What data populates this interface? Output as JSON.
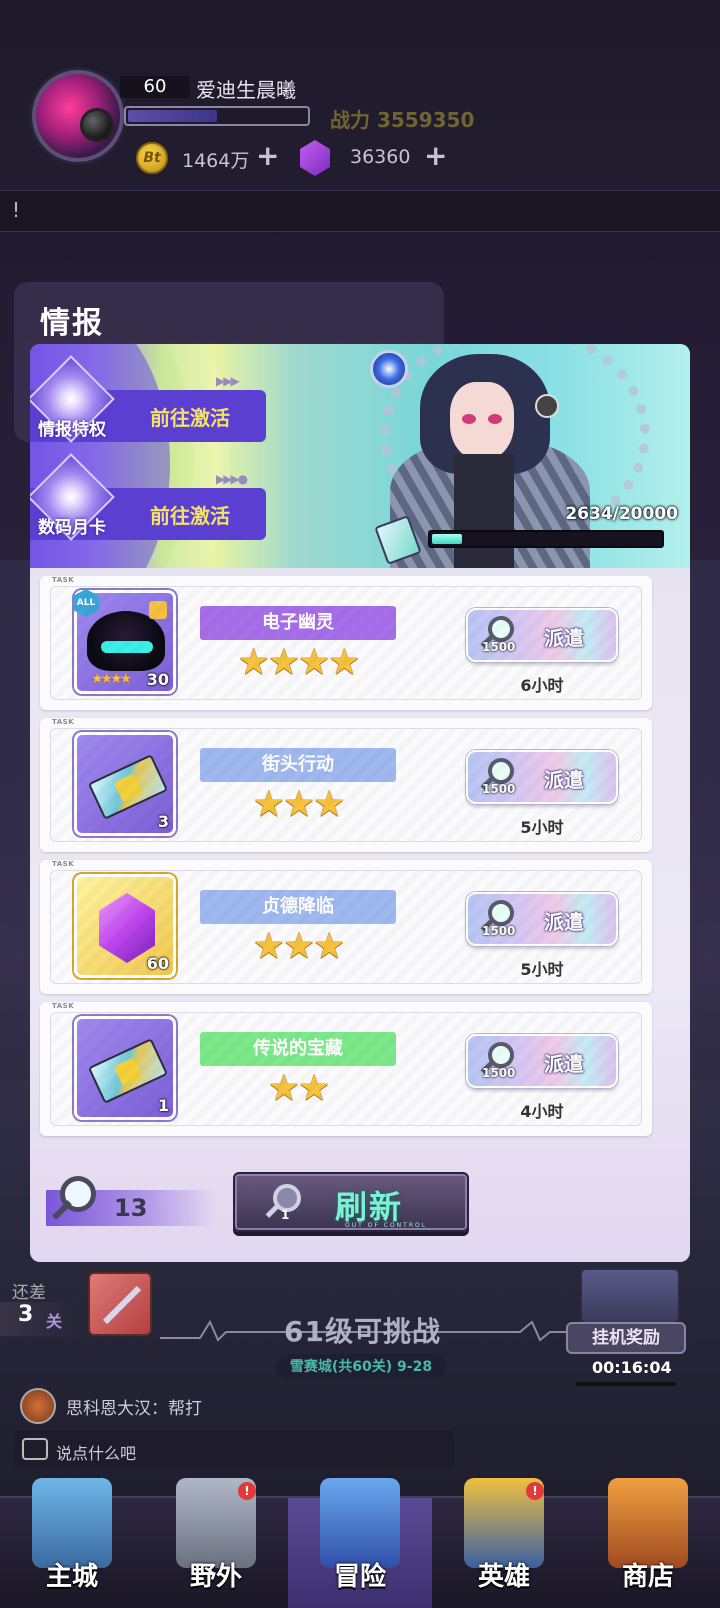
{
  "player": {
    "level": "60",
    "name": "爱迪生晨曦",
    "power_label": "战力 3559350",
    "xp_fraction": 0.49,
    "gold": "1464万",
    "gems": "36360"
  },
  "notice": "!",
  "modal": {
    "title": "情报",
    "privileges": [
      {
        "label": "情报特权",
        "action": "前往激活"
      },
      {
        "label": "数码月卡",
        "action": "前往激活"
      }
    ],
    "progress_text": "2634/20000",
    "progress_fraction": 0.1317,
    "tasks": [
      {
        "tag": "TASK",
        "item_kind": "hero",
        "badge": "ALL",
        "count": "30",
        "name": "电子幽灵",
        "name_color": "purple",
        "stars": 4,
        "cost": "1500",
        "action": "派遣",
        "duration": "6小时"
      },
      {
        "tag": "TASK",
        "item_kind": "ticket",
        "count": "3",
        "name": "街头行动",
        "name_color": "blue",
        "stars": 3,
        "cost": "1500",
        "action": "派遣",
        "duration": "5小时"
      },
      {
        "tag": "TASK",
        "item_kind": "gem",
        "count": "60",
        "name": "贞德降临",
        "name_color": "blue",
        "stars": 3,
        "cost": "1500",
        "action": "派遣",
        "duration": "5小时"
      },
      {
        "tag": "TASK",
        "item_kind": "ticket",
        "count": "1",
        "name": "传说的宝藏",
        "name_color": "green",
        "stars": 2,
        "cost": "1500",
        "action": "派遣",
        "duration": "4小时"
      }
    ],
    "scope_count": "13",
    "refresh": {
      "label": "刷新",
      "cost": "1"
    }
  },
  "stage": {
    "remain_label": "还差",
    "remain_num": "3",
    "remain_unit": "关",
    "challenge": "61级可挑战",
    "stage_name": "雪赛城(共60关) 9-28",
    "afk_label": "挂机奖励",
    "afk_timer": "00:16:04"
  },
  "chat": {
    "message": "思科恩大汉：帮打",
    "placeholder": "说点什么吧"
  },
  "nav": [
    {
      "label": "主城",
      "icon": "city-icon",
      "badge": false,
      "active": false
    },
    {
      "label": "野外",
      "icon": "wild-icon",
      "badge": true,
      "active": false
    },
    {
      "label": "冒险",
      "icon": "adventure-icon",
      "badge": false,
      "active": true
    },
    {
      "label": "英雄",
      "icon": "hero-icon",
      "badge": true,
      "active": false
    },
    {
      "label": "商店",
      "icon": "shop-icon",
      "badge": false,
      "active": false
    }
  ],
  "colors": {
    "accent_purple": "#a66ee8",
    "accent_blue": "#9fb8ef",
    "accent_green": "#7ce88a",
    "star_gold": "#f7c23d",
    "refresh_text": "#7ef0d8"
  }
}
